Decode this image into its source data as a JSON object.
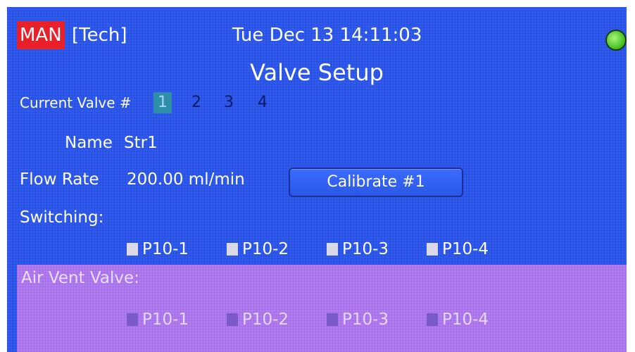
{
  "header": {
    "mode": "MAN",
    "role": "[Tech]",
    "datetime": "Tue Dec 13 14:11:03",
    "status_color": "#4fc42a"
  },
  "title": "Valve Setup",
  "current_valve": {
    "label": "Current Valve #",
    "options": [
      "1",
      "2",
      "3",
      "4"
    ],
    "selected": "1"
  },
  "name": {
    "label": "Name",
    "value": "Str1"
  },
  "flow_rate": {
    "label": "Flow Rate",
    "value": "200.00 ml/min"
  },
  "calibrate_button": "Calibrate #1",
  "switching": {
    "label": "Switching:",
    "ports": [
      "P10-1",
      "P10-2",
      "P10-3",
      "P10-4"
    ],
    "checked": [
      false,
      false,
      false,
      false
    ]
  },
  "air_vent": {
    "label": "Air Vent Valve:",
    "ports": [
      "P10-1",
      "P10-2",
      "P10-3",
      "P10-4"
    ],
    "checked": [
      false,
      false,
      false,
      false
    ]
  },
  "colors": {
    "screen_bg": "#2f5bf0",
    "mode_badge": "#e8202a",
    "selected_valve": "#2f8fa8",
    "air_panel": "#b07cf2"
  }
}
